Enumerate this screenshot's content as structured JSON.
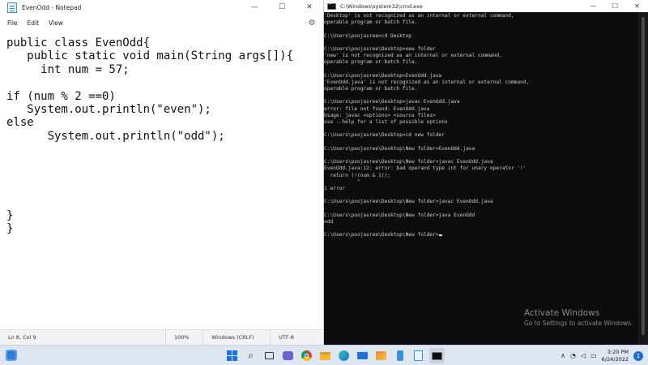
{
  "notepad": {
    "title": "EvenOdd - Notepad",
    "menu": [
      "File",
      "Edit",
      "View"
    ],
    "lines": [
      "public class EvenOdd{",
      "   public static void main(String args[]){",
      "     int num = 57;",
      "",
      "if (num % 2 ==0)",
      "   System.out.println(\"even\");",
      "else",
      "      System.out.println(\"odd\");",
      "",
      "",
      "",
      "",
      "",
      "}",
      "}"
    ],
    "status": {
      "position": "Ln 8, Col 9",
      "zoom": "100%",
      "line_ending": "Windows (CRLF)",
      "encoding": "UTF-8"
    }
  },
  "cmd": {
    "title": "C:\\Windows\\system32\\cmd.exe",
    "lines": [
      "'Desktop' is not recognized as an internal or external command,",
      "operable program or batch file.",
      "",
      "C:\\Users\\poojasree>cd Desktop",
      "",
      "C:\\Users\\poojasree\\Desktop>new folder",
      "'new' is not recognized as an internal or external command,",
      "operable program or batch file.",
      "",
      "C:\\Users\\poojasree\\Desktop>EvenOdd.java",
      "'EvenOdd.java' is not recognized as an internal or external command,",
      "operable program or batch file.",
      "",
      "C:\\Users\\poojasree\\Desktop>javac EvenOdd.java",
      "error: file not found: EvenOdd.java",
      "Usage: javac <options> <source files>",
      "use --help for a list of possible options",
      "",
      "C:\\Users\\poojasree\\Desktop>cd new folder",
      "",
      "C:\\Users\\poojasree\\Desktop\\New folder>EvenOdd.java",
      "",
      "C:\\Users\\poojasree\\Desktop\\New folder>javac EvenOdd.java",
      "EvenOdd.java:12: error: bad operand type int for unary operator '!'",
      "  return (!(num & 1));",
      "           ^",
      "1 error",
      "",
      "C:\\Users\\poojasree\\Desktop\\New folder>javac EvenOdd.java",
      "",
      "C:\\Users\\poojasree\\Desktop\\New folder>java EvenOdd",
      "odd",
      "",
      "C:\\Users\\poojasree\\Desktop\\New folder>"
    ],
    "watermark": {
      "title": "Activate Windows",
      "subtitle": "Go to Settings to activate Windows."
    }
  },
  "taskbar": {
    "time": "3:20 PM",
    "date": "6/24/2022",
    "notification_count": "1",
    "icons": [
      "windows-start-icon",
      "search-icon",
      "task-view-icon",
      "chat-icon",
      "chrome-icon",
      "file-explorer-icon",
      "edge-icon",
      "mail-icon",
      "photos-icon",
      "phone-link-icon",
      "notepad-icon",
      "terminal-icon"
    ],
    "colors": {
      "taskbar_bg": "#dde6f1",
      "accent": "#1a73d9"
    }
  }
}
